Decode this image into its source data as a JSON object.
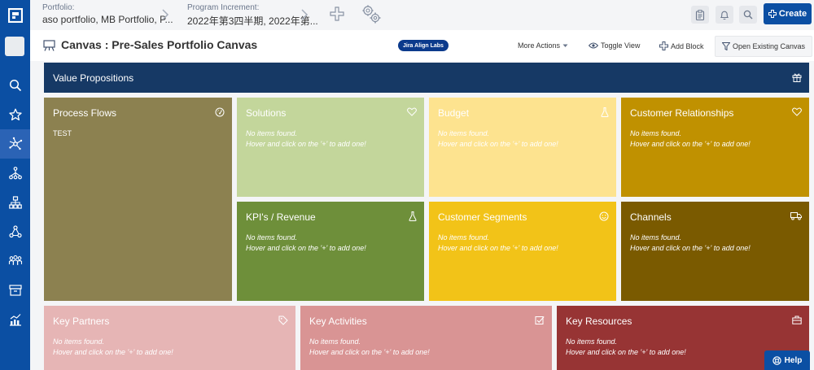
{
  "topbar": {
    "portfolio_label": "Portfolio:",
    "portfolio_value": "aso portfolio, MB Portfolio, P...",
    "pi_label": "Program Increment:",
    "pi_value": "2022年第3四半期, 2022年第...",
    "create_label": "Create"
  },
  "header": {
    "title": "Canvas : Pre-Sales Portfolio Canvas",
    "badge": "Jira Align Labs",
    "more_actions": "More Actions",
    "toggle_view": "Toggle View",
    "add_block": "Add Block",
    "open_existing": "Open Existing Canvas"
  },
  "value_propositions": {
    "title": "Value Propositions"
  },
  "empty": {
    "line1": "No items found.",
    "line2": "Hover and click on the '+' to add one!"
  },
  "blocks": {
    "process_flows": {
      "title": "Process Flows",
      "item": "TEST",
      "color": "#8c8150"
    },
    "solutions": {
      "title": "Solutions",
      "color": "#c3d69b"
    },
    "budget": {
      "title": "Budget",
      "color": "#fde38f"
    },
    "customer_relationships": {
      "title": "Customer Relationships",
      "color": "#c09100"
    },
    "kpis_revenue": {
      "title": "KPI's / Revenue",
      "color": "#6e8f3a"
    },
    "customer_segments": {
      "title": "Customer Segments",
      "color": "#f2c318"
    },
    "channels": {
      "title": "Channels",
      "color": "#7a5a00"
    },
    "key_partners": {
      "title": "Key Partners",
      "color": "#e6b5b5"
    },
    "key_activities": {
      "title": "Key Activities",
      "color": "#d99494"
    },
    "key_resources": {
      "title": "Key Resources",
      "color": "#973434"
    }
  },
  "help": {
    "label": "Help"
  }
}
